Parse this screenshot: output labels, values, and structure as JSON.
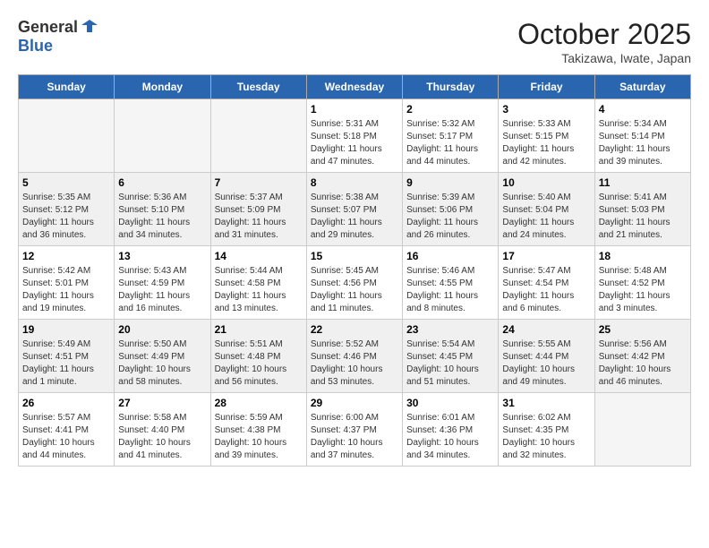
{
  "header": {
    "logo_general": "General",
    "logo_blue": "Blue",
    "month": "October 2025",
    "location": "Takizawa, Iwate, Japan"
  },
  "weekdays": [
    "Sunday",
    "Monday",
    "Tuesday",
    "Wednesday",
    "Thursday",
    "Friday",
    "Saturday"
  ],
  "weeks": [
    [
      {
        "day": "",
        "info": ""
      },
      {
        "day": "",
        "info": ""
      },
      {
        "day": "",
        "info": ""
      },
      {
        "day": "1",
        "info": "Sunrise: 5:31 AM\nSunset: 5:18 PM\nDaylight: 11 hours and 47 minutes."
      },
      {
        "day": "2",
        "info": "Sunrise: 5:32 AM\nSunset: 5:17 PM\nDaylight: 11 hours and 44 minutes."
      },
      {
        "day": "3",
        "info": "Sunrise: 5:33 AM\nSunset: 5:15 PM\nDaylight: 11 hours and 42 minutes."
      },
      {
        "day": "4",
        "info": "Sunrise: 5:34 AM\nSunset: 5:14 PM\nDaylight: 11 hours and 39 minutes."
      }
    ],
    [
      {
        "day": "5",
        "info": "Sunrise: 5:35 AM\nSunset: 5:12 PM\nDaylight: 11 hours and 36 minutes."
      },
      {
        "day": "6",
        "info": "Sunrise: 5:36 AM\nSunset: 5:10 PM\nDaylight: 11 hours and 34 minutes."
      },
      {
        "day": "7",
        "info": "Sunrise: 5:37 AM\nSunset: 5:09 PM\nDaylight: 11 hours and 31 minutes."
      },
      {
        "day": "8",
        "info": "Sunrise: 5:38 AM\nSunset: 5:07 PM\nDaylight: 11 hours and 29 minutes."
      },
      {
        "day": "9",
        "info": "Sunrise: 5:39 AM\nSunset: 5:06 PM\nDaylight: 11 hours and 26 minutes."
      },
      {
        "day": "10",
        "info": "Sunrise: 5:40 AM\nSunset: 5:04 PM\nDaylight: 11 hours and 24 minutes."
      },
      {
        "day": "11",
        "info": "Sunrise: 5:41 AM\nSunset: 5:03 PM\nDaylight: 11 hours and 21 minutes."
      }
    ],
    [
      {
        "day": "12",
        "info": "Sunrise: 5:42 AM\nSunset: 5:01 PM\nDaylight: 11 hours and 19 minutes."
      },
      {
        "day": "13",
        "info": "Sunrise: 5:43 AM\nSunset: 4:59 PM\nDaylight: 11 hours and 16 minutes."
      },
      {
        "day": "14",
        "info": "Sunrise: 5:44 AM\nSunset: 4:58 PM\nDaylight: 11 hours and 13 minutes."
      },
      {
        "day": "15",
        "info": "Sunrise: 5:45 AM\nSunset: 4:56 PM\nDaylight: 11 hours and 11 minutes."
      },
      {
        "day": "16",
        "info": "Sunrise: 5:46 AM\nSunset: 4:55 PM\nDaylight: 11 hours and 8 minutes."
      },
      {
        "day": "17",
        "info": "Sunrise: 5:47 AM\nSunset: 4:54 PM\nDaylight: 11 hours and 6 minutes."
      },
      {
        "day": "18",
        "info": "Sunrise: 5:48 AM\nSunset: 4:52 PM\nDaylight: 11 hours and 3 minutes."
      }
    ],
    [
      {
        "day": "19",
        "info": "Sunrise: 5:49 AM\nSunset: 4:51 PM\nDaylight: 11 hours and 1 minute."
      },
      {
        "day": "20",
        "info": "Sunrise: 5:50 AM\nSunset: 4:49 PM\nDaylight: 10 hours and 58 minutes."
      },
      {
        "day": "21",
        "info": "Sunrise: 5:51 AM\nSunset: 4:48 PM\nDaylight: 10 hours and 56 minutes."
      },
      {
        "day": "22",
        "info": "Sunrise: 5:52 AM\nSunset: 4:46 PM\nDaylight: 10 hours and 53 minutes."
      },
      {
        "day": "23",
        "info": "Sunrise: 5:54 AM\nSunset: 4:45 PM\nDaylight: 10 hours and 51 minutes."
      },
      {
        "day": "24",
        "info": "Sunrise: 5:55 AM\nSunset: 4:44 PM\nDaylight: 10 hours and 49 minutes."
      },
      {
        "day": "25",
        "info": "Sunrise: 5:56 AM\nSunset: 4:42 PM\nDaylight: 10 hours and 46 minutes."
      }
    ],
    [
      {
        "day": "26",
        "info": "Sunrise: 5:57 AM\nSunset: 4:41 PM\nDaylight: 10 hours and 44 minutes."
      },
      {
        "day": "27",
        "info": "Sunrise: 5:58 AM\nSunset: 4:40 PM\nDaylight: 10 hours and 41 minutes."
      },
      {
        "day": "28",
        "info": "Sunrise: 5:59 AM\nSunset: 4:38 PM\nDaylight: 10 hours and 39 minutes."
      },
      {
        "day": "29",
        "info": "Sunrise: 6:00 AM\nSunset: 4:37 PM\nDaylight: 10 hours and 37 minutes."
      },
      {
        "day": "30",
        "info": "Sunrise: 6:01 AM\nSunset: 4:36 PM\nDaylight: 10 hours and 34 minutes."
      },
      {
        "day": "31",
        "info": "Sunrise: 6:02 AM\nSunset: 4:35 PM\nDaylight: 10 hours and 32 minutes."
      },
      {
        "day": "",
        "info": ""
      }
    ]
  ]
}
